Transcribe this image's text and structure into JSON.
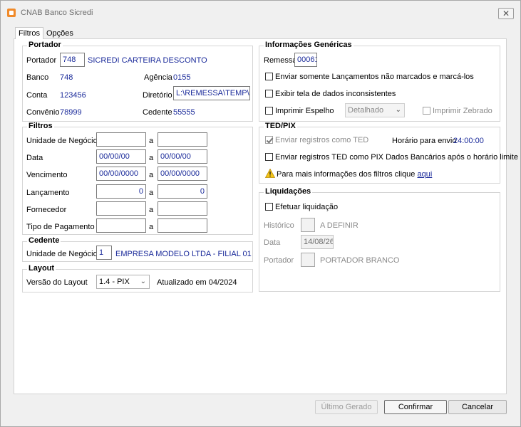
{
  "window": {
    "title": "CNAB Banco Sicredi",
    "close_glyph": "✕"
  },
  "tabs": [
    {
      "label": "Filtros",
      "active": true
    },
    {
      "label": "Opções",
      "active": false
    }
  ],
  "portador": {
    "title": "Portador",
    "portador_label": "Portador",
    "portador_code": "748",
    "portador_name": "SICREDI CARTEIRA DESCONTO",
    "banco_label": "Banco",
    "banco_value": "748",
    "agencia_label": "Agência",
    "agencia_value": "0155",
    "conta_label": "Conta",
    "conta_value": "123456",
    "diretorio_label": "Diretório",
    "diretorio_value": "L:\\REMESSA\\TEMP\\",
    "convenio_label": "Convênio",
    "convenio_value": "78999",
    "cedente_label": "Cedente",
    "cedente_value": "55555"
  },
  "filtros": {
    "title": "Filtros",
    "rows": [
      {
        "label": "Unidade de Negócio",
        "from": "",
        "to": ""
      },
      {
        "label": "Data",
        "from": "00/00/00",
        "to": "00/00/00"
      },
      {
        "label": "Vencimento",
        "from": "00/00/0000",
        "to": "00/00/0000"
      },
      {
        "label": "Lançamento",
        "from": "0",
        "to": "0"
      },
      {
        "label": "Fornecedor",
        "from": "",
        "to": ""
      },
      {
        "label": "Tipo de Pagamento",
        "from": "",
        "to": ""
      }
    ],
    "sep": "a"
  },
  "cedente": {
    "title": "Cedente",
    "label": "Unidade de Negócio",
    "code": "1",
    "name": "EMPRESA MODELO LTDA - FILIAL 01"
  },
  "layout": {
    "title": "Layout",
    "version_label": "Versão do Layout",
    "version_value": "1.4 - PIX",
    "updated_text": "Atualizado em 04/2024"
  },
  "info": {
    "title": "Informações Genéricas",
    "remessa_label": "Remessa",
    "remessa_value": "00061",
    "opt1": "Enviar somente Lançamentos não marcados e marcá-los",
    "opt2": "Exibir tela de dados inconsistentes",
    "opt3": "Imprimir Espelho",
    "espelho_combo": "Detalhado",
    "opt4": "Imprimir Zebrado"
  },
  "tedpix": {
    "title": "TED/PIX",
    "opt1": "Enviar registros como TED",
    "horario_label": "Horário para envio",
    "horario_value": "24:00:00",
    "opt2": "Enviar registros TED como PIX Dados Bancários após o horário limite",
    "warn_text": "Para mais informações dos filtros clique",
    "warn_link": "aqui"
  },
  "liquidacoes": {
    "title": "Liquidações",
    "opt": "Efetuar liquidação",
    "historico_label": "Histórico",
    "historico_text": "A DEFINIR",
    "data_label": "Data",
    "data_value": "14/08/26",
    "portador_label": "Portador",
    "portador_text": "PORTADOR BRANCO"
  },
  "buttons": {
    "ultimo": "Último Gerado",
    "confirmar": "Confirmar",
    "cancelar": "Cancelar"
  }
}
